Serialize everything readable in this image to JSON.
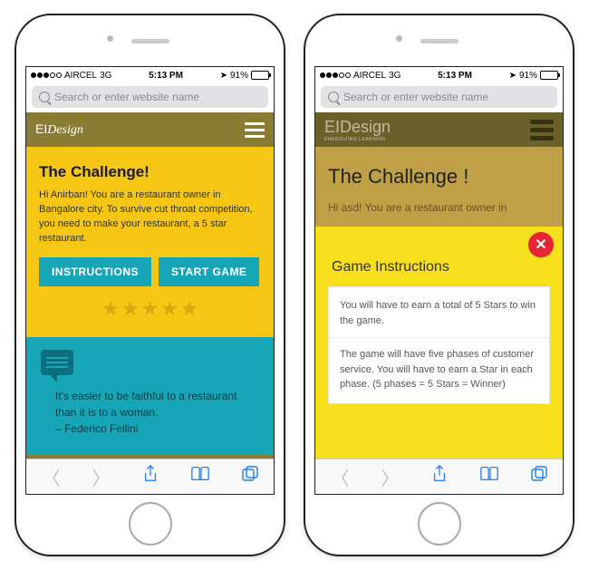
{
  "status": {
    "carrier": "AIRCEL",
    "network": "3G",
    "time": "5:13 PM",
    "battery_pct": "91%"
  },
  "browser": {
    "search_placeholder": "Search or enter website name"
  },
  "phone1": {
    "brand_ei": "EI",
    "brand_design": "Design",
    "title": "The Challenge!",
    "body": "Hi Anirban! You are a restaurant owner in Bangalore city. To survive cut throat competition, you need to make your restaurant, a 5 star restaurant.",
    "btn_instructions": "INSTRUCTIONS",
    "btn_start": "START GAME",
    "quote": "It's easier to be faithful to a restaurant than it is to a woman.",
    "quote_author": "– Federico Fellini"
  },
  "phone2": {
    "brand_ei": "EI",
    "brand_design": "Design",
    "brand_sub": "ENERGIZING LEARNING",
    "title": "The Challenge !",
    "body": "Hi asd! You are a restaurant owner in",
    "overlay_title": "Game Instructions",
    "instr1": "You will have to earn a total of 5 Stars to win the game.",
    "instr2": "The game will have five phases of customer service. You will have to earn a Star in each phase. (5 phases = 5 Stars = Winner)"
  }
}
